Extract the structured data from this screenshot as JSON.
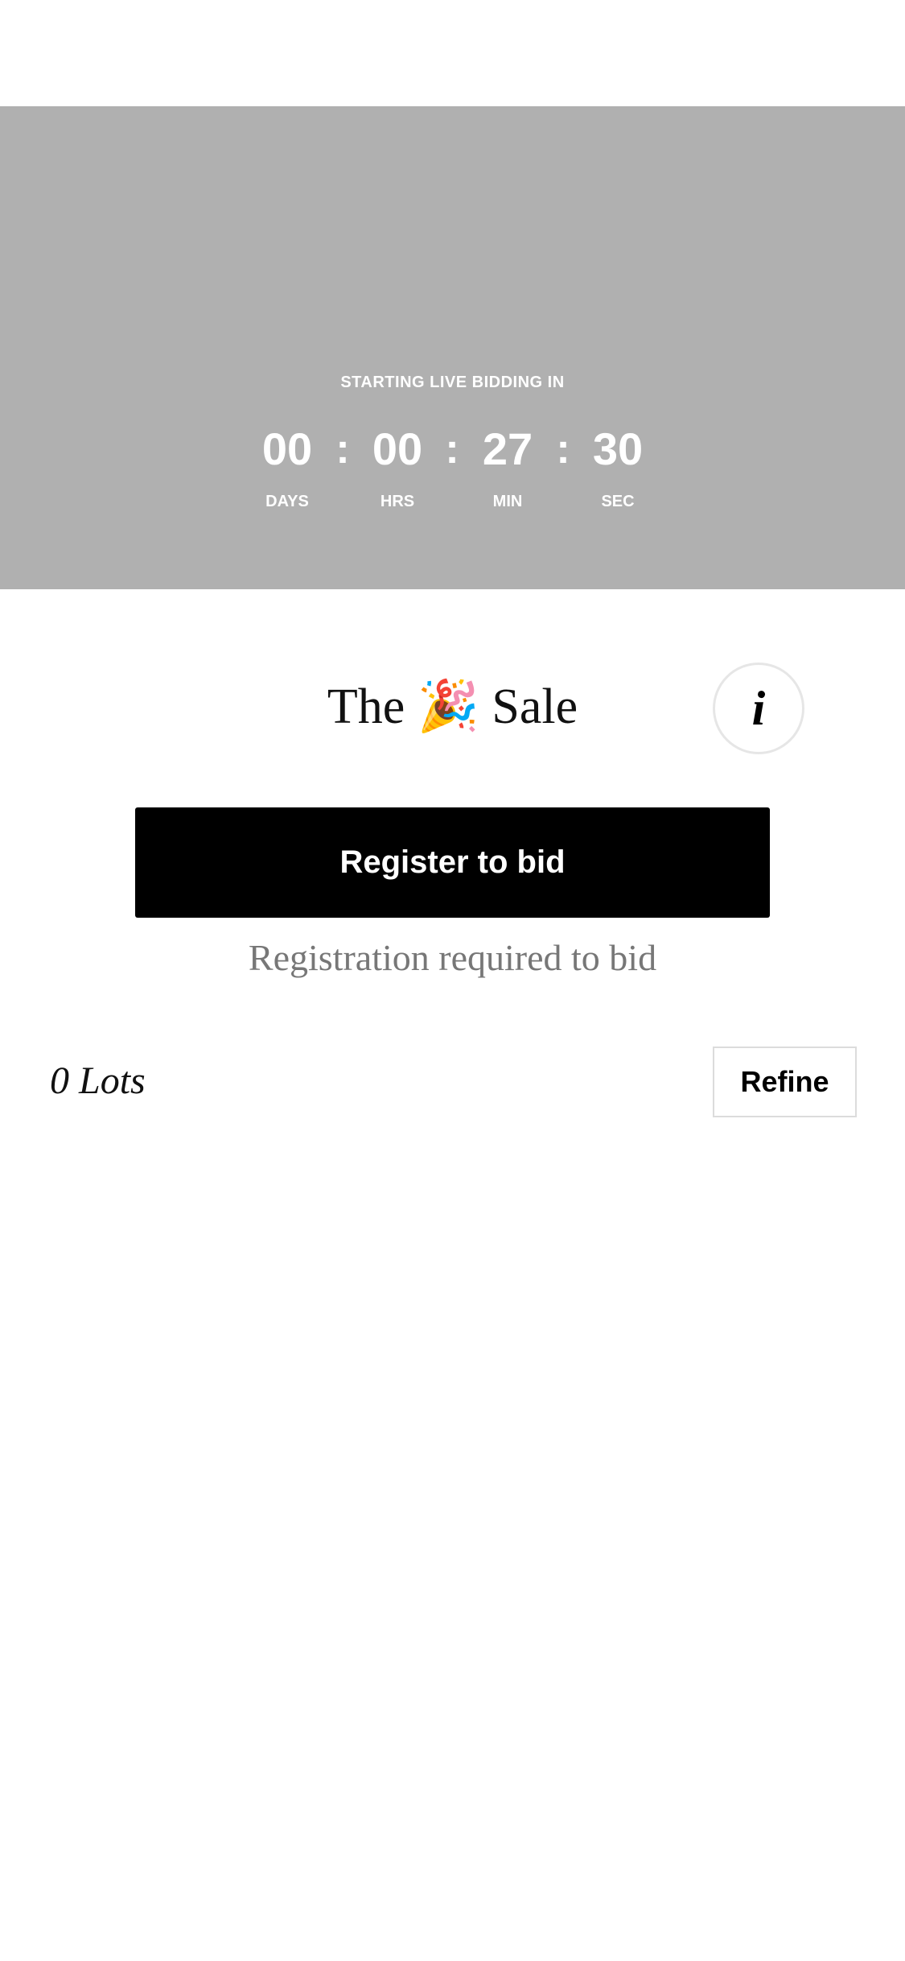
{
  "countdown": {
    "heading": "STARTING LIVE BIDDING IN",
    "days": "00",
    "hours": "00",
    "minutes": "27",
    "seconds": "30",
    "separator": ":",
    "days_label": "DAYS",
    "hours_label": "HRS",
    "minutes_label": "MIN",
    "seconds_label": "SEC"
  },
  "sale": {
    "title": "The 🎉 Sale",
    "info_glyph": "i"
  },
  "register": {
    "button_label": "Register to bid",
    "note": "Registration required to bid"
  },
  "lots": {
    "count_label": "0 Lots",
    "refine_label": "Refine"
  },
  "colors": {
    "hero_background": "#b0b0b0",
    "primary_button": "#000000",
    "note_text": "#777777"
  }
}
